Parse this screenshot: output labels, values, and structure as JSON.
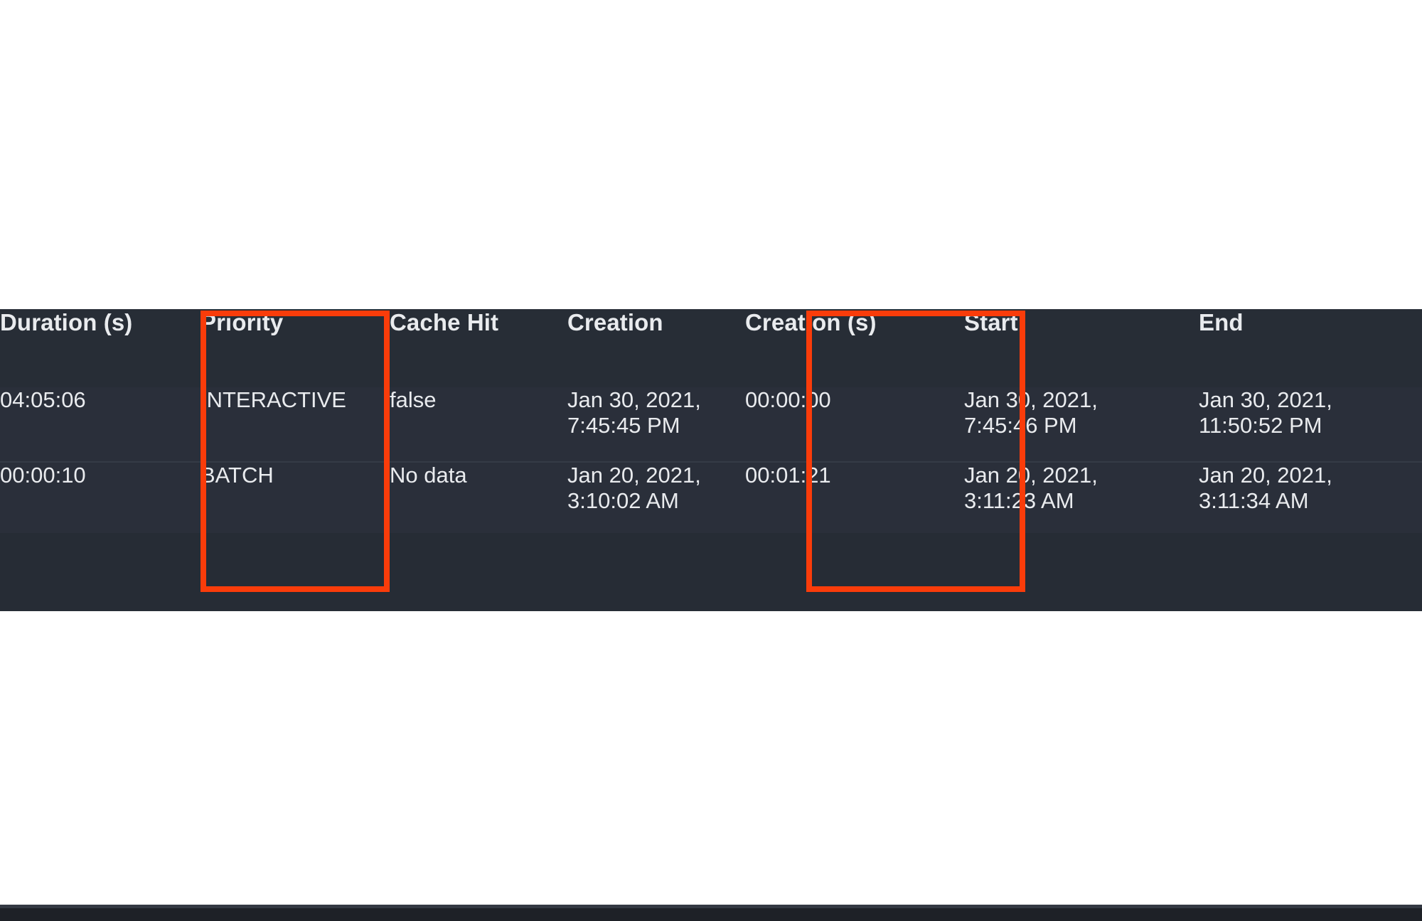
{
  "table": {
    "name": "job-results-table",
    "columns": [
      {
        "key": "duration",
        "label": "Duration (s)"
      },
      {
        "key": "priority",
        "label": "Priority"
      },
      {
        "key": "cache_hit",
        "label": "Cache Hit"
      },
      {
        "key": "creation",
        "label": "Creation"
      },
      {
        "key": "creation_s",
        "label": "Creation (s)"
      },
      {
        "key": "start",
        "label": "Start"
      },
      {
        "key": "end",
        "label": "End"
      }
    ],
    "rows": [
      {
        "duration": "04:05:06",
        "priority": "INTERACTIVE",
        "cache_hit": "false",
        "creation_date": "Jan 30, 2021,",
        "creation_time": "7:45:45 PM",
        "creation_s": "00:00:00",
        "start_date": "Jan 30, 2021,",
        "start_time": "7:45:46 PM",
        "end_date": "Jan 30, 2021,",
        "end_time": "11:50:52 PM"
      },
      {
        "duration": "00:00:10",
        "priority": "BATCH",
        "cache_hit": "No data",
        "creation_date": "Jan 20, 2021,",
        "creation_time": "3:10:02 AM",
        "creation_s": "00:01:21",
        "start_date": "Jan 20, 2021,",
        "start_time": "3:11:23 AM",
        "end_date": "Jan 20, 2021,",
        "end_time": "3:11:34 AM"
      }
    ]
  },
  "annotations": [
    {
      "name": "highlight-priority-column",
      "color": "#fa3c0a",
      "target_column": "Priority"
    },
    {
      "name": "highlight-creation-seconds-column",
      "color": "#fa3c0a",
      "target_column": "Creation (s)"
    }
  ],
  "theme": {
    "page_background": "#ffffff",
    "header_background": "#272d36",
    "row_background": "#2a2f3a",
    "row_divider": "#353b46",
    "footer_bar": "#1e2127",
    "text_primary": "#f1f3f5",
    "text_secondary": "#e4e7ea",
    "annotation_color": "#fa3c0a"
  }
}
